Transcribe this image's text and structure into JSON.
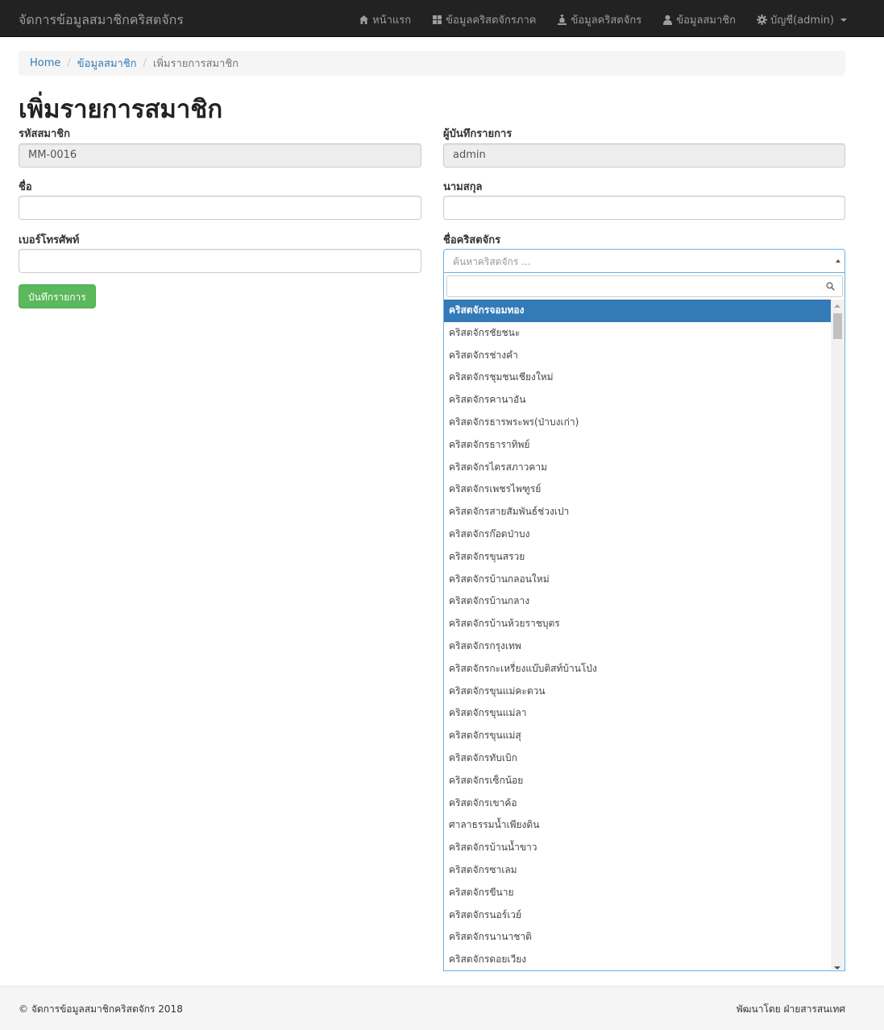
{
  "navbar": {
    "brand": "จัดการข้อมูลสมาชิกคริสตจักร",
    "items": [
      {
        "label": "หน้าแรก",
        "icon": "home-icon"
      },
      {
        "label": "ข้อมูลคริสตจักรภาค",
        "icon": "grid-icon"
      },
      {
        "label": "ข้อมูลคริสตจักร",
        "icon": "church-icon"
      },
      {
        "label": "ข้อมูลสมาชิก",
        "icon": "user-icon"
      },
      {
        "label": "บัญชี(admin)",
        "icon": "gear-icon"
      }
    ]
  },
  "breadcrumb": {
    "home": "Home",
    "members": "ข้อมูลสมาชิก",
    "current": "เพิ่มรายการสมาชิก"
  },
  "page_title": "เพิ่มรายการสมาชิก",
  "form": {
    "member_id_label": "รหัสสมาชิก",
    "member_id_value": "MM-0016",
    "recorder_label": "ผู้บันทึกรายการ",
    "recorder_value": "admin",
    "firstname_label": "ชื่อ",
    "firstname_value": "",
    "lastname_label": "นามสกุล",
    "lastname_value": "",
    "phone_label": "เบอร์โทรศัพท์",
    "phone_value": "",
    "church_label": "ชื่อคริสตจักร",
    "church_placeholder": "ค้นหาคริสตจักร ...",
    "search_value": "",
    "save_button": "บันทึกรายการ"
  },
  "church_options": [
    "คริสตจักรจอมทอง",
    "คริสตจักรชัยชนะ",
    "คริสตจักรช่างคำ",
    "คริสตจักรชุมชนเชียงใหม่",
    "คริสตจักรคานาอัน",
    "คริสตจักรธารพระพร(ป่าบงเก่า)",
    "คริสตจักรธาราทิพย์",
    "คริสตจักรไตรสภาวคาม",
    "คริสตจักรเพชรไพฑูรย์",
    "คริสตจักรสายสัมพันธ์ช่วงเปา",
    "คริสตจักรก๊อดป่าบง",
    "คริสตจักรขุนสรวย",
    "คริสตจักรบ้านกลอนใหม่",
    "คริสตจักรบ้านกลาง",
    "คริสตจักรบ้านห้วยราชบุตร",
    "คริสตจักรกรุงเทพ",
    "คริสตจักรกะเหรี่ยงแบ๊บติสท์บ้านโป่ง",
    "คริสตจักรขุนแม่คะตวน",
    "คริสตจักรขุนแม่ลา",
    "คริสตจักรขุนแม่สุ",
    "คริสตจักรทับเบิก",
    "คริสตจักรเซ็กน้อย",
    "คริสตจักรเขาค้อ",
    "ศาลาธรรมน้ำเพียงดิน",
    "คริสตจักรบ้านน้ำขาว",
    "คริสตจักรซาเลม",
    "คริสตจักรขีนาย",
    "คริสตจักรนอร์เวย์",
    "คริสตจักรนานาชาติ",
    "คริสตจักรดอยเวียง"
  ],
  "footer": {
    "copyright": "© จัดการข้อมูลสมาชิกคริสตจักร 2018",
    "credit": "พัฒนาโดย ฝ่ายสารสนเทศ"
  },
  "colors": {
    "navbar_bg": "#222222",
    "link": "#337ab7",
    "save_button": "#5cb85c",
    "highlight": "#337ab7",
    "focus_border": "#66afe9"
  }
}
